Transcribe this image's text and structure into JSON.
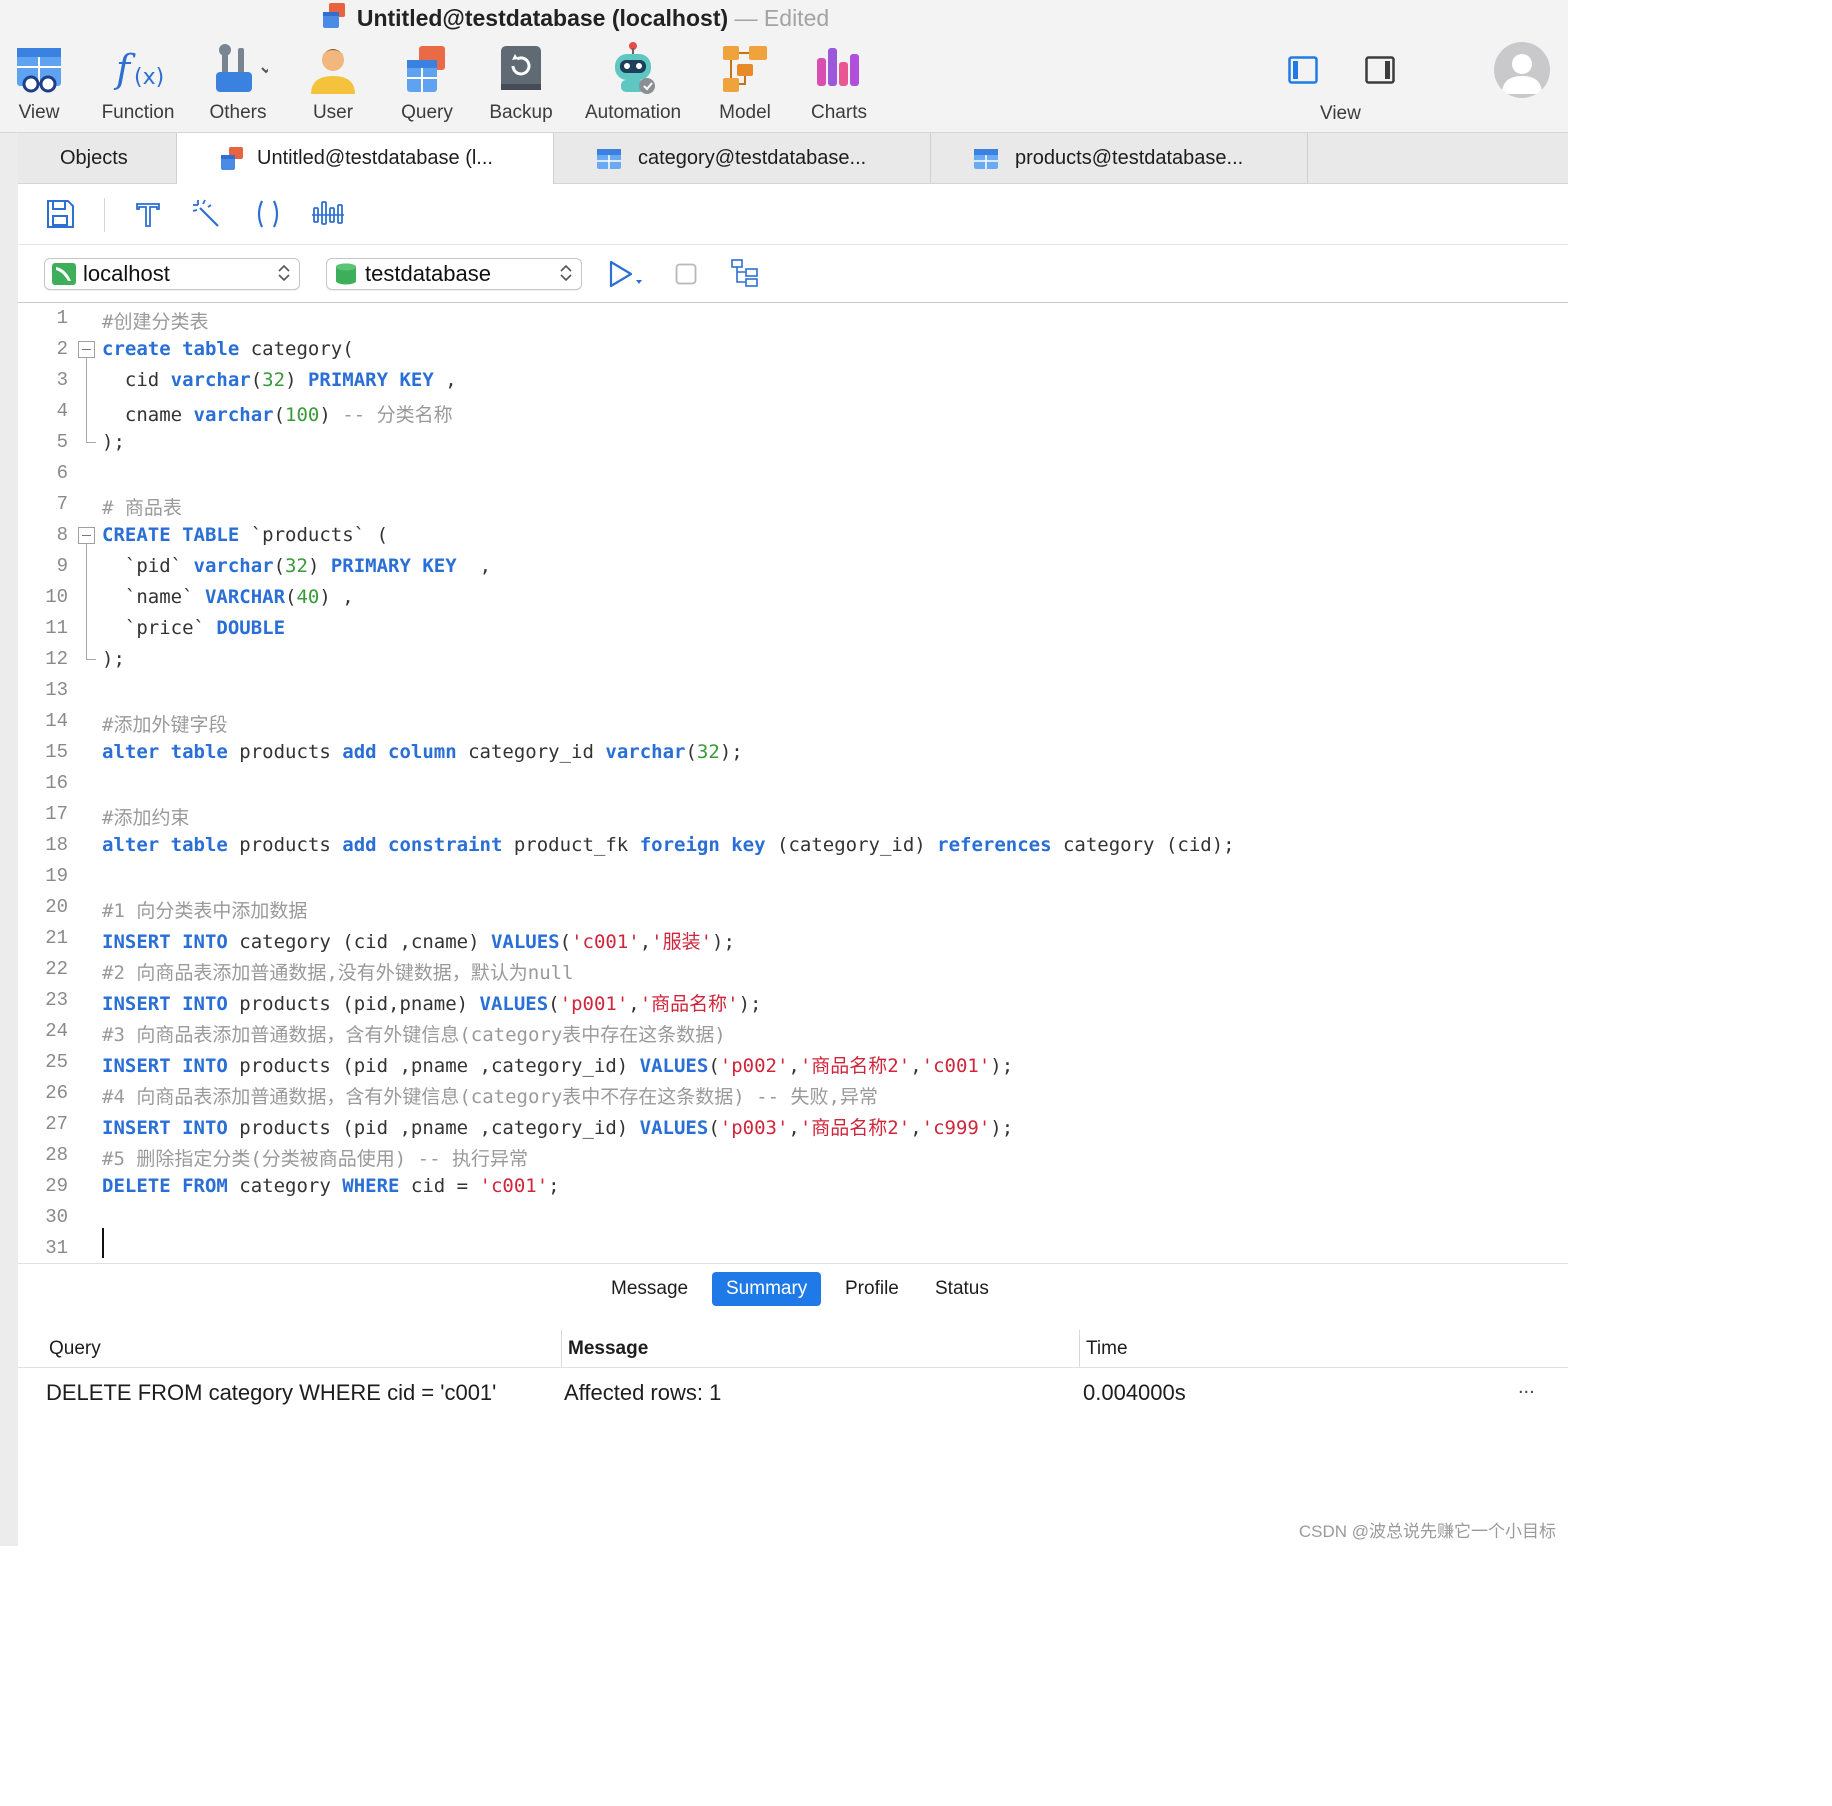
{
  "window": {
    "title": "Untitled@testdatabase (localhost)",
    "status": "— Edited"
  },
  "toolbar": [
    {
      "label": "View",
      "icon": "view-table-icon"
    },
    {
      "label": "Function",
      "icon": "function-fx-icon"
    },
    {
      "label": "Others",
      "icon": "tools-icon"
    },
    {
      "label": "User",
      "icon": "user-icon"
    },
    {
      "label": "Query",
      "icon": "query-icon"
    },
    {
      "label": "Backup",
      "icon": "backup-icon"
    },
    {
      "label": "Automation",
      "icon": "robot-icon"
    },
    {
      "label": "Model",
      "icon": "model-icon"
    },
    {
      "label": "Charts",
      "icon": "charts-icon"
    }
  ],
  "view_group": {
    "label": "View"
  },
  "tabs": [
    {
      "label": "Objects"
    },
    {
      "label": "Untitled@testdatabase (l..."
    },
    {
      "label": "category@testdatabase..."
    },
    {
      "label": "products@testdatabase..."
    }
  ],
  "connection": {
    "server": "localhost",
    "database": "testdatabase"
  },
  "editor": {
    "line_numbers": [
      "1",
      "2",
      "3",
      "4",
      "5",
      "6",
      "7",
      "8",
      "9",
      "10",
      "11",
      "12",
      "13",
      "14",
      "15",
      "16",
      "17",
      "18",
      "19",
      "20",
      "21",
      "22",
      "23",
      "24",
      "25",
      "26",
      "27",
      "28",
      "29",
      "30",
      "31"
    ],
    "lines": [
      "#创建分类表",
      "create table category(",
      "  cid varchar(32) PRIMARY KEY ,",
      "  cname varchar(100) -- 分类名称",
      ");",
      "",
      "# 商品表",
      "CREATE TABLE `products` (",
      "  `pid` varchar(32) PRIMARY KEY  ,",
      "  `name` VARCHAR(40) ,",
      "  `price` DOUBLE",
      ");",
      "",
      "#添加外键字段",
      "alter table products add column category_id varchar(32);",
      "",
      "#添加约束",
      "alter table products add constraint product_fk foreign key (category_id) references category (cid);",
      "",
      "#1 向分类表中添加数据",
      "INSERT INTO category (cid ,cname) VALUES('c001','服装');",
      "#2 向商品表添加普通数据,没有外键数据，默认为null",
      "INSERT INTO products (pid,pname) VALUES('p001','商品名称');",
      "#3 向商品表添加普通数据，含有外键信息(category表中存在这条数据)",
      "INSERT INTO products (pid ,pname ,category_id) VALUES('p002','商品名称2','c001');",
      "#4 向商品表添加普通数据，含有外键信息(category表中不存在这条数据) -- 失败,异常",
      "INSERT INTO products (pid ,pname ,category_id) VALUES('p003','商品名称2','c999');",
      "#5 删除指定分类(分类被商品使用) -- 执行异常",
      "DELETE FROM category WHERE cid = 'c001';",
      "",
      ""
    ]
  },
  "result_tabs": [
    {
      "label": "Message"
    },
    {
      "label": "Summary"
    },
    {
      "label": "Profile"
    },
    {
      "label": "Status"
    }
  ],
  "results": {
    "columns": [
      "Query",
      "Message",
      "Time"
    ],
    "rows": [
      {
        "query": "DELETE FROM category WHERE cid = 'c001'",
        "message": "Affected rows: 1",
        "time": "0.004000s"
      }
    ],
    "more": "..."
  },
  "watermark": "CSDN @波总说先赚它一个小目标",
  "colors": {
    "accent": "#1f7ae8",
    "keyword": "#2a6fd6",
    "string": "#d0263b",
    "number": "#3a9a3a",
    "comment": "#9a9a9a"
  }
}
